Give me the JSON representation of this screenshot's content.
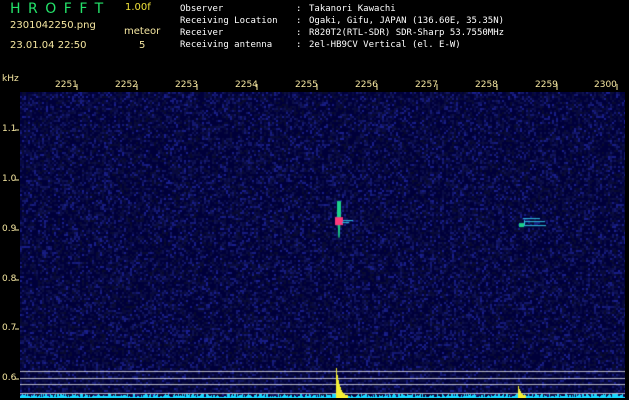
{
  "header": {
    "app_title": "HROFFT",
    "version": "1.00f",
    "file_name": "2301042250.png",
    "mode": "meteor",
    "date_time": "23.01.04 22:50",
    "count": "5"
  },
  "observer_info": [
    {
      "label": "Observer",
      "value": "Takanori Kawachi"
    },
    {
      "label": "Receiving Location",
      "value": "Ogaki, Gifu, JAPAN (136.60E, 35.35N)"
    },
    {
      "label": "Receiver",
      "value": "R820T2(RTL-SDR) SDR-Sharp 53.7550MHz"
    },
    {
      "label": "Receiving antenna",
      "value": "2el-HB9CV Vertical (el. E-W)"
    }
  ],
  "separator": ":",
  "axis": {
    "y_unit": "kHz",
    "x_labels": [
      "2251",
      "2252",
      "2253",
      "2254",
      "2255",
      "2256",
      "2257",
      "2258",
      "2259",
      "2300"
    ],
    "y_labels": [
      "1.1",
      "1.0",
      "0.9",
      "0.8",
      "0.7",
      "0.6"
    ]
  },
  "colors": {
    "background": "#000000",
    "plot_background": "#00003a",
    "title": "#24e36a",
    "version": "#f0e23a",
    "label": "#f6e7a1",
    "text": "#ffffff",
    "echo_core": "#ff3a7d",
    "echo_mid": "#1ccf8a",
    "echo_edge": "#30c3e4",
    "baseline_noise": "#18d8ff",
    "baseline_spike": "#f4ef35",
    "reference_line": "#ffffff"
  },
  "echoes": [
    {
      "minute": "2255",
      "frequency_khz": 0.905,
      "strength": "strong"
    },
    {
      "minute": "2258",
      "frequency_khz": 0.905,
      "strength": "medium"
    }
  ]
}
